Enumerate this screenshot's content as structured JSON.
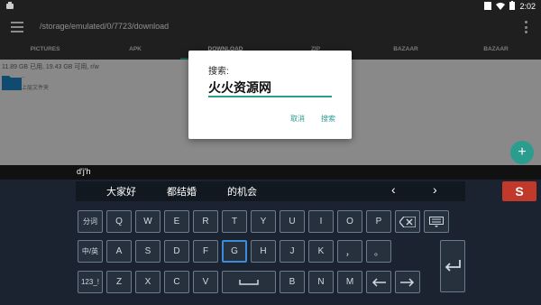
{
  "statusbar": {
    "time": "2:02"
  },
  "appbar": {
    "path": "/storage/emulated/0/7723/download"
  },
  "tabs": [
    "PICTURES",
    "APK",
    "DOWNLOAD",
    "ZIP",
    "BAZAAR",
    "BAZAAR"
  ],
  "content": {
    "storage_info": "11.89 GB 已用, 19.43 GB 可用, r/w",
    "folder_name": "..",
    "folder_desc": "上层文件夹"
  },
  "dialog": {
    "title": "搜索:",
    "input_value": "火火资源网",
    "cancel_label": "取消",
    "search_label": "搜索"
  },
  "keyboard": {
    "composition": "d'j'h",
    "candidates": [
      "大家好",
      "都结婚",
      "的机会"
    ],
    "prev_icon": "chevron-left-icon",
    "next_icon": "chevron-right-icon",
    "row1": [
      "分词",
      "Q",
      "W",
      "E",
      "R",
      "T",
      "Y",
      "U",
      "I",
      "O",
      "P"
    ],
    "row2": [
      "中/英",
      "A",
      "S",
      "D",
      "F",
      "G",
      "H",
      "J",
      "K",
      "，",
      "。"
    ],
    "row3": [
      "123_!",
      "Z",
      "X",
      "C",
      "V",
      "B",
      "N",
      "M"
    ],
    "logo": "S"
  },
  "accent_color": "#2a9d8f"
}
